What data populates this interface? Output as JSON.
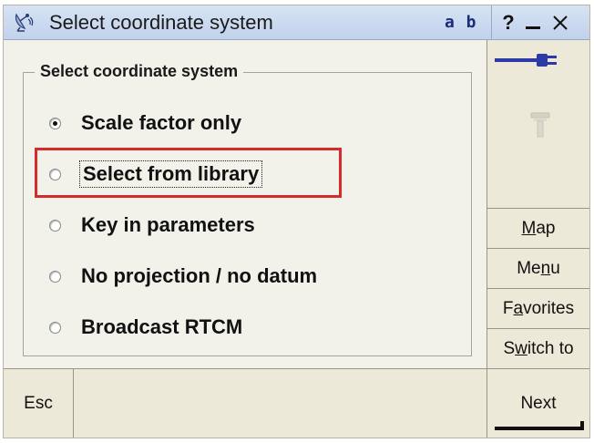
{
  "window": {
    "title": "Select coordinate system",
    "input_mode": "a b",
    "help_label": "?",
    "minimize_label": "–",
    "close_label": "×",
    "icon": "satellite-dish-icon"
  },
  "group": {
    "legend": "Select coordinate system",
    "options": [
      {
        "label": "Scale factor only",
        "checked": true
      },
      {
        "label": "Select from library",
        "checked": false,
        "focused": true,
        "highlighted": true
      },
      {
        "label": "Key in parameters",
        "checked": false
      },
      {
        "label": "No projection / no datum",
        "checked": false
      },
      {
        "label": "Broadcast RTCM",
        "checked": false
      }
    ]
  },
  "status": {
    "power_icon": "plug-icon",
    "receiver_icon": "antenna-icon"
  },
  "side_buttons": {
    "map": {
      "pre": "",
      "u": "M",
      "post": "ap"
    },
    "menu": {
      "pre": "Me",
      "u": "n",
      "post": "u"
    },
    "favorites": {
      "pre": "F",
      "u": "a",
      "post": "vorites"
    },
    "switch_to": {
      "pre": "S",
      "u": "w",
      "post": "itch to"
    }
  },
  "bottom": {
    "esc_label": "Esc",
    "next_label": "Next"
  },
  "colors": {
    "highlight": "#d52b2b",
    "titlebar": "#c8d7ef",
    "background": "#ece9d8"
  }
}
